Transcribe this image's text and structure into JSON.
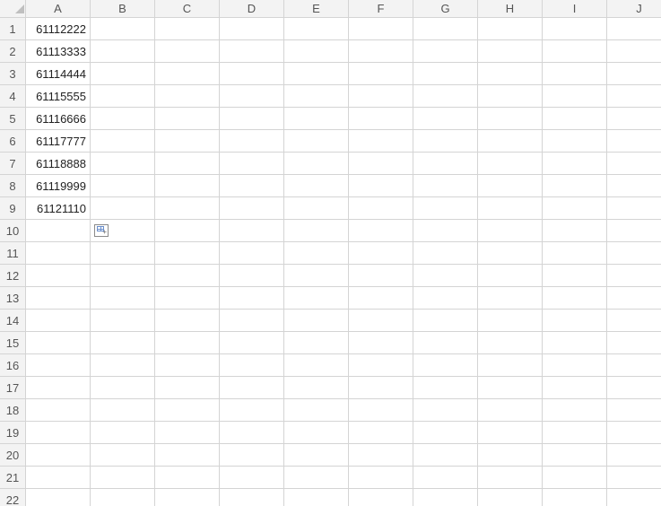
{
  "columns": [
    "A",
    "B",
    "C",
    "D",
    "E",
    "F",
    "G",
    "H",
    "I",
    "J"
  ],
  "rows": [
    1,
    2,
    3,
    4,
    5,
    6,
    7,
    8,
    9,
    10,
    11,
    12,
    13,
    14,
    15,
    16,
    17,
    18,
    19,
    20,
    21,
    22
  ],
  "cells": {
    "A1": "61112222",
    "A2": "61113333",
    "A3": "61114444",
    "A4": "61115555",
    "A5": "61116666",
    "A6": "61117777",
    "A7": "61118888",
    "A8": "61119999",
    "A9": "61121110"
  },
  "autofill_options_at": {
    "col": "B",
    "row": 10
  }
}
